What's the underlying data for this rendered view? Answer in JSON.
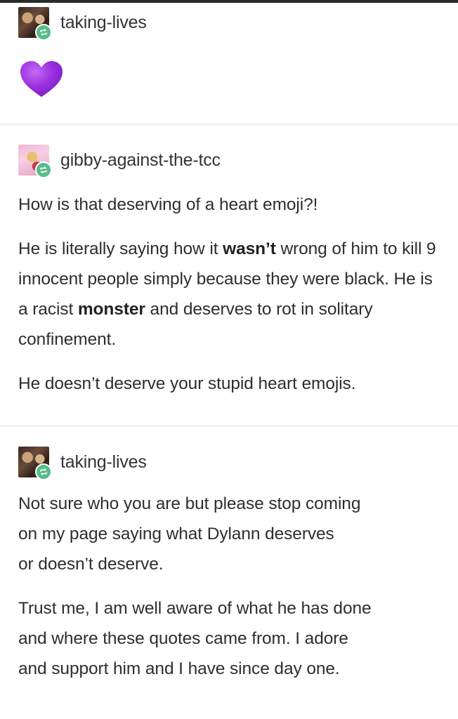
{
  "posts": [
    {
      "username": "taking-lives",
      "avatar": "avatar-dark-photo",
      "content_emoji": "purple-heart-icon"
    },
    {
      "username": "gibby-against-the-tcc",
      "avatar": "avatar-pink-photo",
      "paragraphs": [
        {
          "segments": [
            {
              "text": "How is that deserving of a heart emoji?!",
              "bold": false
            }
          ]
        },
        {
          "segments": [
            {
              "text": "He is literally saying how it ",
              "bold": false
            },
            {
              "text": "wasn’t",
              "bold": true
            },
            {
              "text": " wrong of him to kill 9 innocent people simply because they were black. He is a racist ",
              "bold": false
            },
            {
              "text": "monster",
              "bold": true
            },
            {
              "text": " and deserves to rot in solitary confinement.",
              "bold": false
            }
          ]
        },
        {
          "segments": [
            {
              "text": "He doesn’t deserve your stupid heart emojis.",
              "bold": false
            }
          ]
        }
      ]
    },
    {
      "username": "taking-lives",
      "avatar": "avatar-dark-photo",
      "paragraphs": [
        {
          "lines": [
            "Not sure who you are but please stop coming",
            "on my page saying what Dylann deserves",
            "or doesn’t deserve."
          ]
        },
        {
          "lines": [
            "Trust me, I am well aware of what he has done",
            "and where these quotes came from. I adore",
            "and support him and I have since day one."
          ]
        }
      ]
    }
  ],
  "colors": {
    "reblog_badge": "#56bc8a",
    "heart": "#9b30e0",
    "divider": "#ececec"
  }
}
